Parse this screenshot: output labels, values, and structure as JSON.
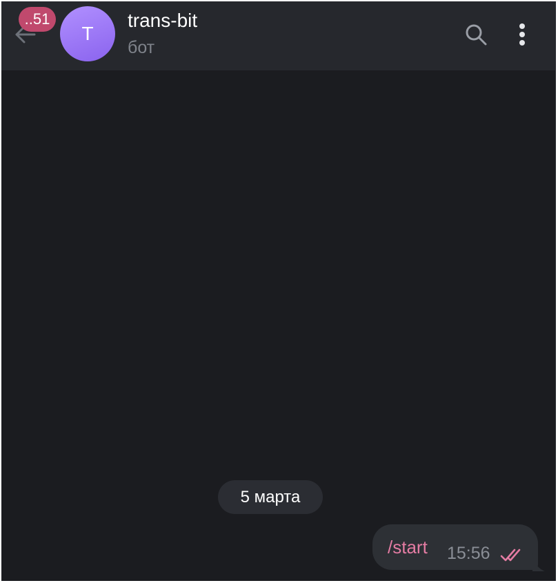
{
  "header": {
    "unread_count": "..51",
    "avatar_letter": "T",
    "title": "trans-bit",
    "subtitle": "бот",
    "back_icon": "arrow-left-icon",
    "search_icon": "search-icon",
    "menu_icon": "more-vertical-icon"
  },
  "chat": {
    "date_separator": "5 марта",
    "messages": [
      {
        "text": "/start",
        "time": "15:56",
        "status_icon": "double-check-icon",
        "outgoing": true
      }
    ]
  },
  "colors": {
    "background": "#1b1c20",
    "header": "#26282d",
    "badge": "#c0496d",
    "accent_text": "#e47ca3",
    "avatar_gradient": [
      "#b190ff",
      "#8a63ee"
    ]
  }
}
